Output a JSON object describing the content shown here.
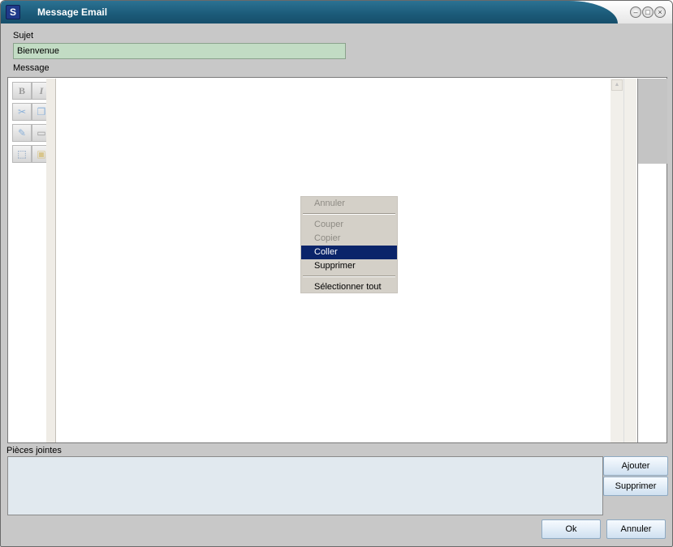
{
  "window": {
    "title": "Message Email",
    "icons": {
      "app": "app-logo-icon",
      "minimize": "minimize-icon",
      "maximize": "maximize-icon",
      "close": "close-icon"
    }
  },
  "subject": {
    "label": "Sujet",
    "value": "Bienvenue"
  },
  "message": {
    "label": "Message"
  },
  "toolbar": {
    "bold": "B",
    "italic": "I",
    "icons": [
      "bold-icon",
      "italic-icon",
      "cut-icon",
      "copy-icon",
      "edit-icon",
      "paste-icon",
      "select-icon",
      "image-icon"
    ]
  },
  "context_menu": {
    "items": [
      {
        "label": "Annuler",
        "state": "disabled"
      },
      {
        "label": "Couper",
        "state": "disabled"
      },
      {
        "label": "Copier",
        "state": "disabled"
      },
      {
        "label": "Coller",
        "state": "selected"
      },
      {
        "label": "Supprimer",
        "state": "enabled"
      },
      {
        "label": "Sélectionner tout",
        "state": "enabled"
      }
    ]
  },
  "attachments": {
    "label": "Pièces jointes",
    "add_button": "Ajouter",
    "remove_button": "Supprimer"
  },
  "footer": {
    "ok_button": "Ok",
    "cancel_button": "Annuler"
  },
  "colors": {
    "title_bar": "#1b5a78",
    "subject_bg": "#c2dcc4",
    "menu_selected": "#0a246a",
    "attach_bg": "#e1e9ef"
  }
}
